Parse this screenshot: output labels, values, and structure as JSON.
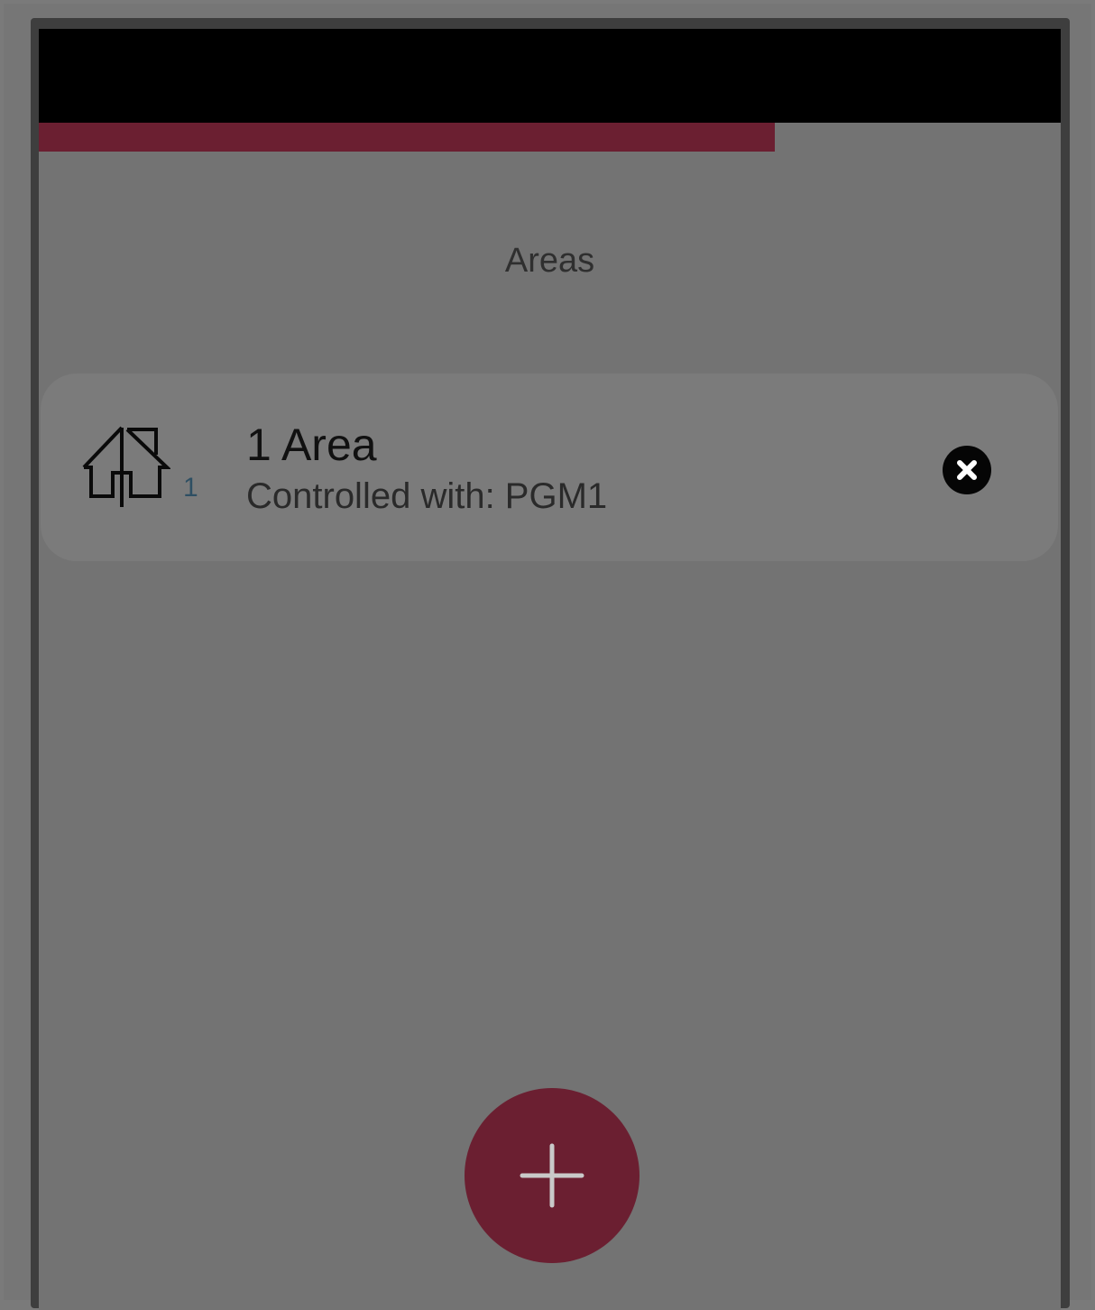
{
  "colors": {
    "accent": "#6b1f31",
    "screen_bg": "#737373",
    "status_bar": "#000000"
  },
  "progress": {
    "value": 0.72
  },
  "header": {
    "title": "Areas"
  },
  "areas": [
    {
      "name": "1 Area",
      "index": "1",
      "subtitle": "Controlled with: PGM1",
      "icon": "house-split-icon",
      "remove_icon": "close-circle-icon"
    }
  ],
  "fab": {
    "icon": "plus-icon",
    "caption": ""
  }
}
